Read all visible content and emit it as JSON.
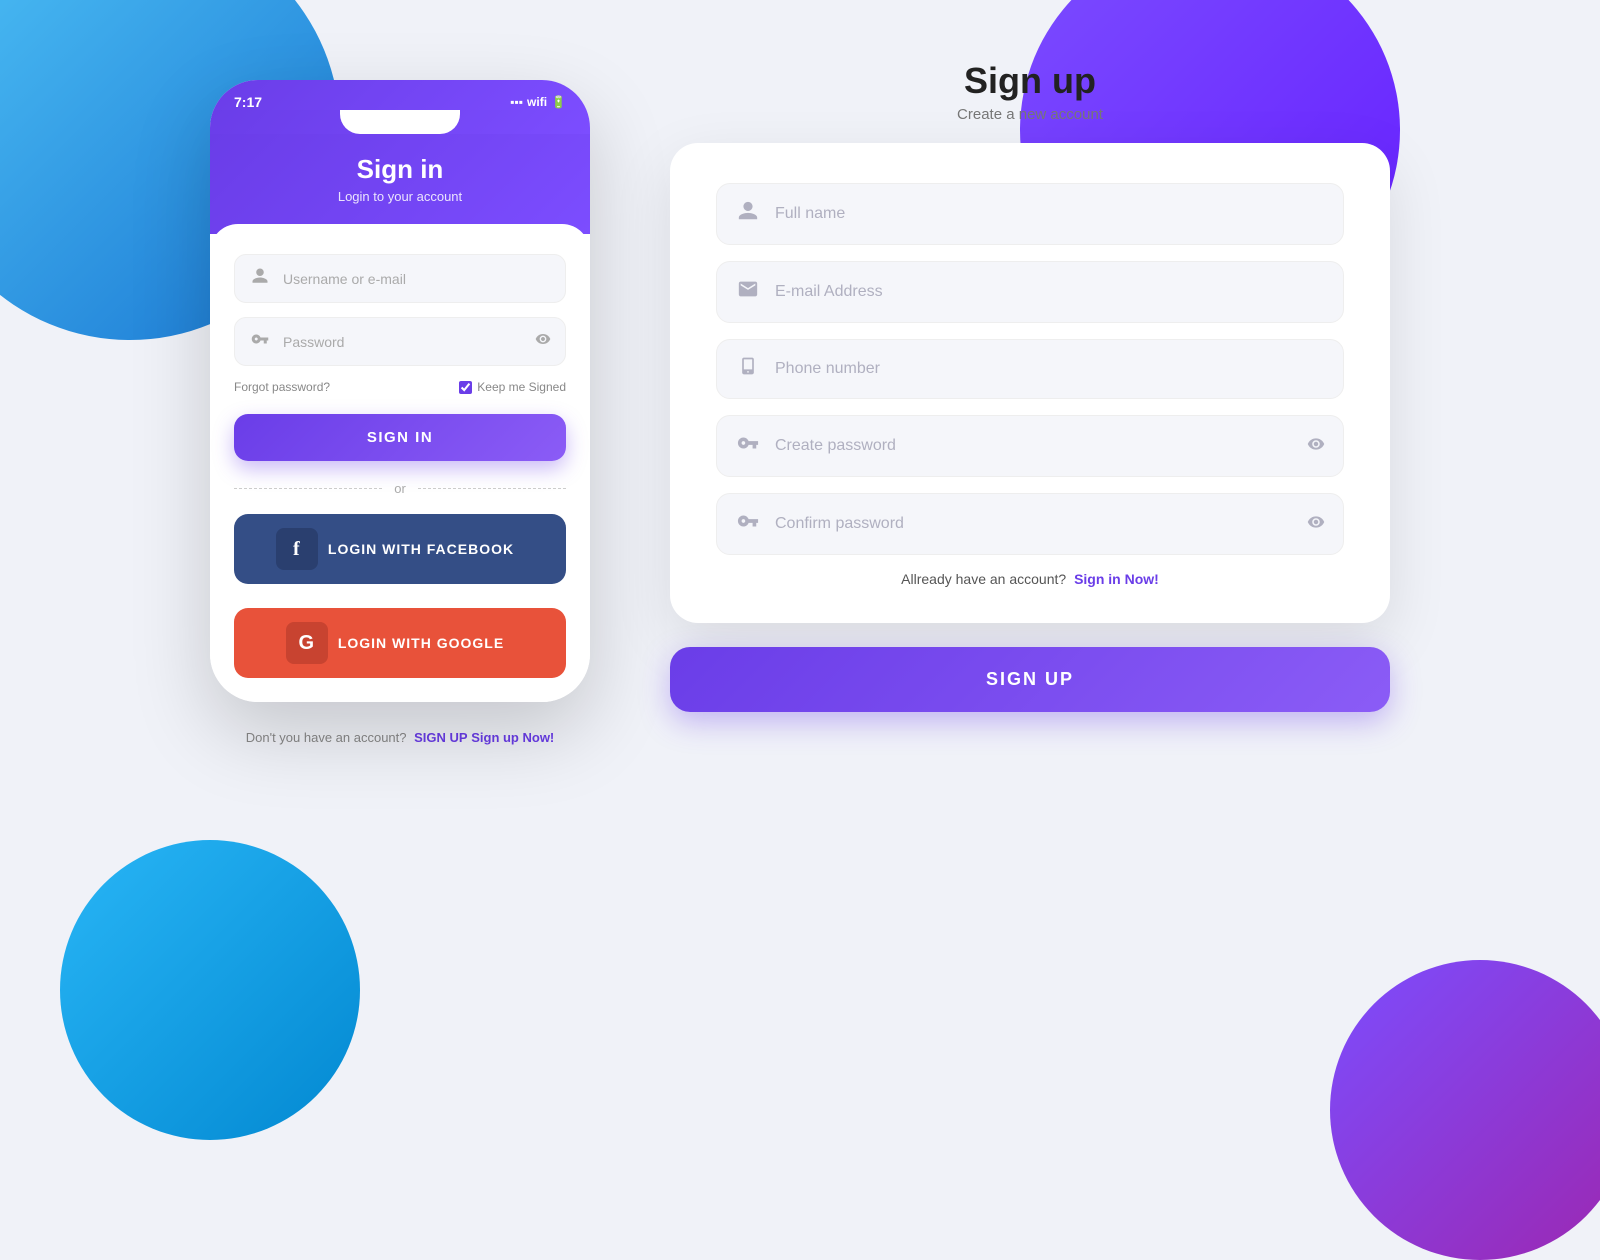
{
  "background": {
    "color": "#f0f2f8"
  },
  "signin": {
    "status_time": "7:17",
    "title": "Sign in",
    "subtitle": "Login to your account",
    "username_placeholder": "Username or e-mail",
    "password_placeholder": "Password",
    "forgot_password": "Forgot password?",
    "keep_signed_label": "Keep me Signed",
    "signin_button": "SIGN IN",
    "divider_text": "or",
    "facebook_button": "LOGIN WITH FACEBOOK",
    "google_button": "LOGIN WITH GOOGLE",
    "bottom_text": "Don't you have an account?",
    "bottom_link": "Sign up Now!"
  },
  "signup": {
    "title": "Sign up",
    "subtitle": "Create a new account",
    "fullname_placeholder": "Full name",
    "email_placeholder": "E-mail Address",
    "phone_placeholder": "Phone number",
    "create_password_placeholder": "Create password",
    "confirm_password_placeholder": "Confirm password",
    "already_text": "Allready have an account?",
    "already_link": "Sign in Now!",
    "signup_button": "SIGN UP"
  },
  "icons": {
    "user": "👤",
    "key": "🗝",
    "eye": "👁",
    "mail": "✉",
    "phone": "📱",
    "facebook": "f",
    "google": "G"
  }
}
